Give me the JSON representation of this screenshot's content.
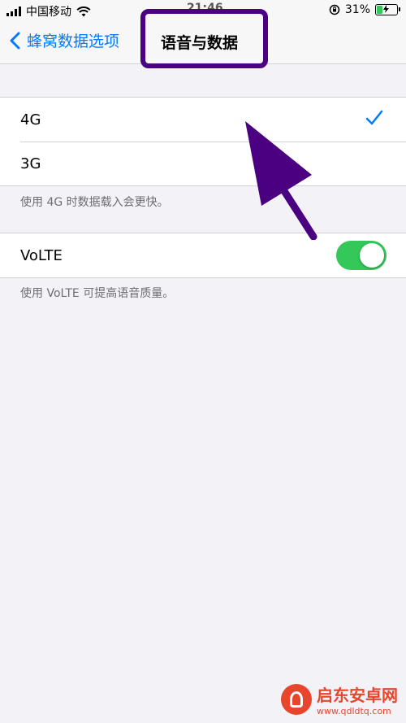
{
  "status_bar": {
    "carrier": "中国移动",
    "time": "21:46",
    "battery_percent": "31%",
    "battery_level": 0.31,
    "icons": [
      "signal-icon",
      "wifi-icon",
      "orientation-lock-icon",
      "battery-charging-icon"
    ]
  },
  "nav": {
    "back_label": "蜂窝数据选项",
    "title": "语音与数据"
  },
  "network_group": {
    "options": [
      {
        "label": "4G",
        "selected": true
      },
      {
        "label": "3G",
        "selected": false
      }
    ],
    "footer": "使用 4G 时数据载入会更快。"
  },
  "volte_group": {
    "label": "VoLTE",
    "enabled": true,
    "footer": "使用 VoLTE 可提高语音质量。"
  },
  "annotation": {
    "highlight_color": "#4b0082",
    "arrow_color": "#4b0082"
  },
  "watermark": {
    "name": "启东安卓网",
    "url": "www.qdldtq.com"
  },
  "colors": {
    "accent": "#007aff",
    "toggle_on": "#34c759",
    "background": "#f2f2f7"
  }
}
